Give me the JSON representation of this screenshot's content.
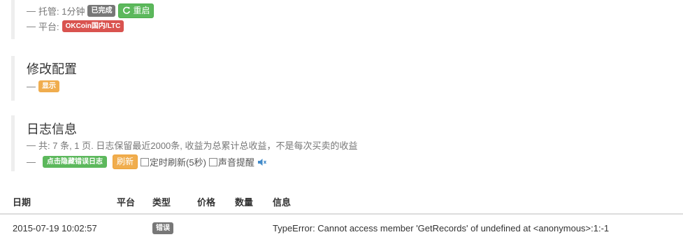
{
  "status": {
    "hosting_label": "托管: 1分钟",
    "hosting_state": "已完成",
    "restart_label": "重启",
    "platform_label": "平台:",
    "platform_value": "OKCoin国内/LTC"
  },
  "config": {
    "title": "修改配置",
    "show_label": "显示"
  },
  "log": {
    "title": "日志信息",
    "summary": "共: 7 条, 1 页. 日志保留最近2000条, 收益为总累计总收益，不是每次买卖的收益",
    "hide_errors_label": "点击隐藏错误日志",
    "refresh_label": "刷新",
    "auto_refresh_label": "定时刷新(5秒)",
    "sound_label": "声音提醒"
  },
  "table": {
    "headers": {
      "date": "日期",
      "platform": "平台",
      "type": "类型",
      "price": "价格",
      "amount": "数量",
      "info": "信息"
    },
    "rows": [
      {
        "date": "2015-07-19 10:02:57",
        "platform": "",
        "type": "错误",
        "price": "",
        "amount": "",
        "info": "TypeError: Cannot access member 'GetRecords' of undefined at <anonymous>:1:-1"
      }
    ]
  },
  "colors": {
    "success": "#5cb85c",
    "warning": "#f0ad4e",
    "danger": "#d9534f",
    "default": "#777777"
  }
}
